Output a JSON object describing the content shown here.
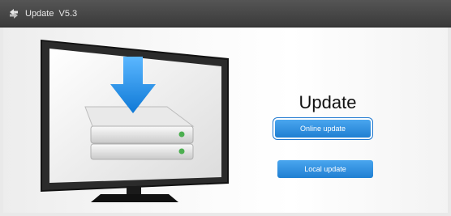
{
  "titlebar": {
    "icon": "sync-arrows-icon",
    "title": "Update",
    "version": "V5.3"
  },
  "main": {
    "heading": "Update",
    "buttons": {
      "online_label": "Online update",
      "local_label": "Local update"
    },
    "illustration": "tv-download-icon"
  },
  "colors": {
    "titlebar": "#3f3f3f",
    "button": "#2b8fe0",
    "arrow": "#1e8ff0"
  }
}
